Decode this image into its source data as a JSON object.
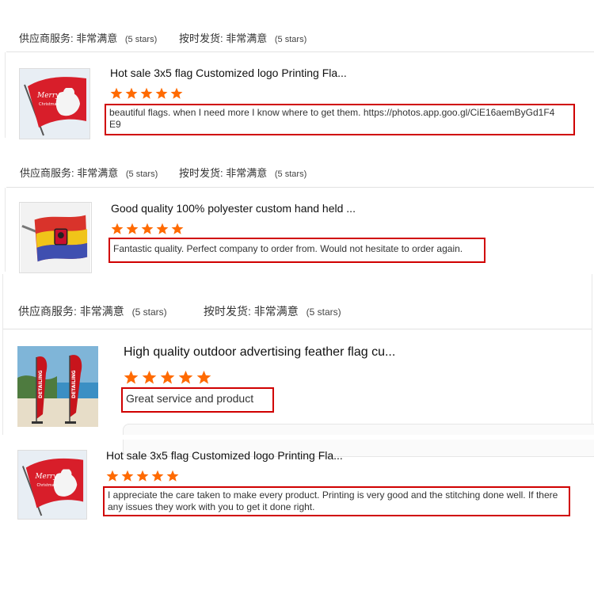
{
  "colors": {
    "star": "#ff6a00",
    "highlight": "#d00000"
  },
  "ratings": {
    "supplier_service_label": "供应商服务:",
    "supplier_service_value": "非常满意",
    "supplier_service_stars": "(5 stars)",
    "on_time_label": "按时发货:",
    "on_time_value": "非常满意",
    "on_time_stars": "(5 stars)"
  },
  "reviews": [
    {
      "product_title": "Hot sale 3x5 flag Customized logo Printing Fla...",
      "rating": 5,
      "image_icon": "christmas-flag-image",
      "text_line1": "beautiful flags. when I need more I know where to get them. https://photos.app.goo.gl/CiE16aemByGd1F4",
      "text_line2": "E9"
    },
    {
      "product_title": "Good quality 100% polyester custom hand held ...",
      "rating": 5,
      "image_icon": "striped-hand-flag-image",
      "text_line1": "Fantastic quality. Perfect company to order from. Would not hesitate to order again."
    },
    {
      "product_title": "High quality outdoor advertising feather flag cu...",
      "rating": 5,
      "image_icon": "feather-flag-beach-image",
      "text_line1": "Great service and product",
      "flag_text": "DETAILING"
    },
    {
      "product_title": "Hot sale 3x5 flag Customized logo Printing Fla...",
      "rating": 5,
      "image_icon": "christmas-flag-image",
      "text_line1": "I appreciate the care taken to make every product. Printing is very good and the stitching done well. If there",
      "text_line2": "any issues they work with you to get it done right."
    }
  ]
}
